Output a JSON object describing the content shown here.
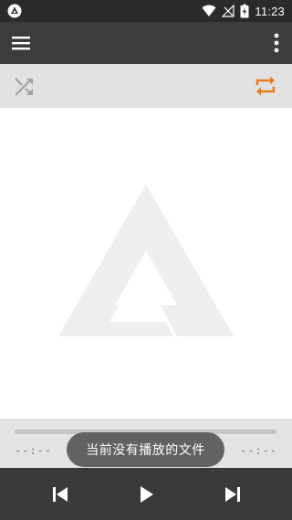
{
  "status_bar": {
    "time": "11:23",
    "icons": [
      "app-indicator-icon",
      "wifi-icon",
      "signal-icon",
      "battery-charging-icon"
    ]
  },
  "toolbar": {
    "menu_icon": "menu-icon",
    "more_icon": "more-vert-icon"
  },
  "mode_bar": {
    "shuffle_icon": "shuffle-icon",
    "repeat_icon": "repeat-icon",
    "shuffle_color": "#9e9e9e",
    "repeat_color": "#e57b1e"
  },
  "player": {
    "elapsed": "--:--",
    "duration": "--:--",
    "progress": 0
  },
  "toast": {
    "message": "当前没有播放的文件"
  },
  "controls": {
    "prev_icon": "skip-previous-icon",
    "play_icon": "play-icon",
    "next_icon": "skip-next-icon"
  },
  "colors": {
    "toolbar": "#3c3c3c",
    "status_bar": "#2b2b2b",
    "accent": "#e57b1e"
  }
}
